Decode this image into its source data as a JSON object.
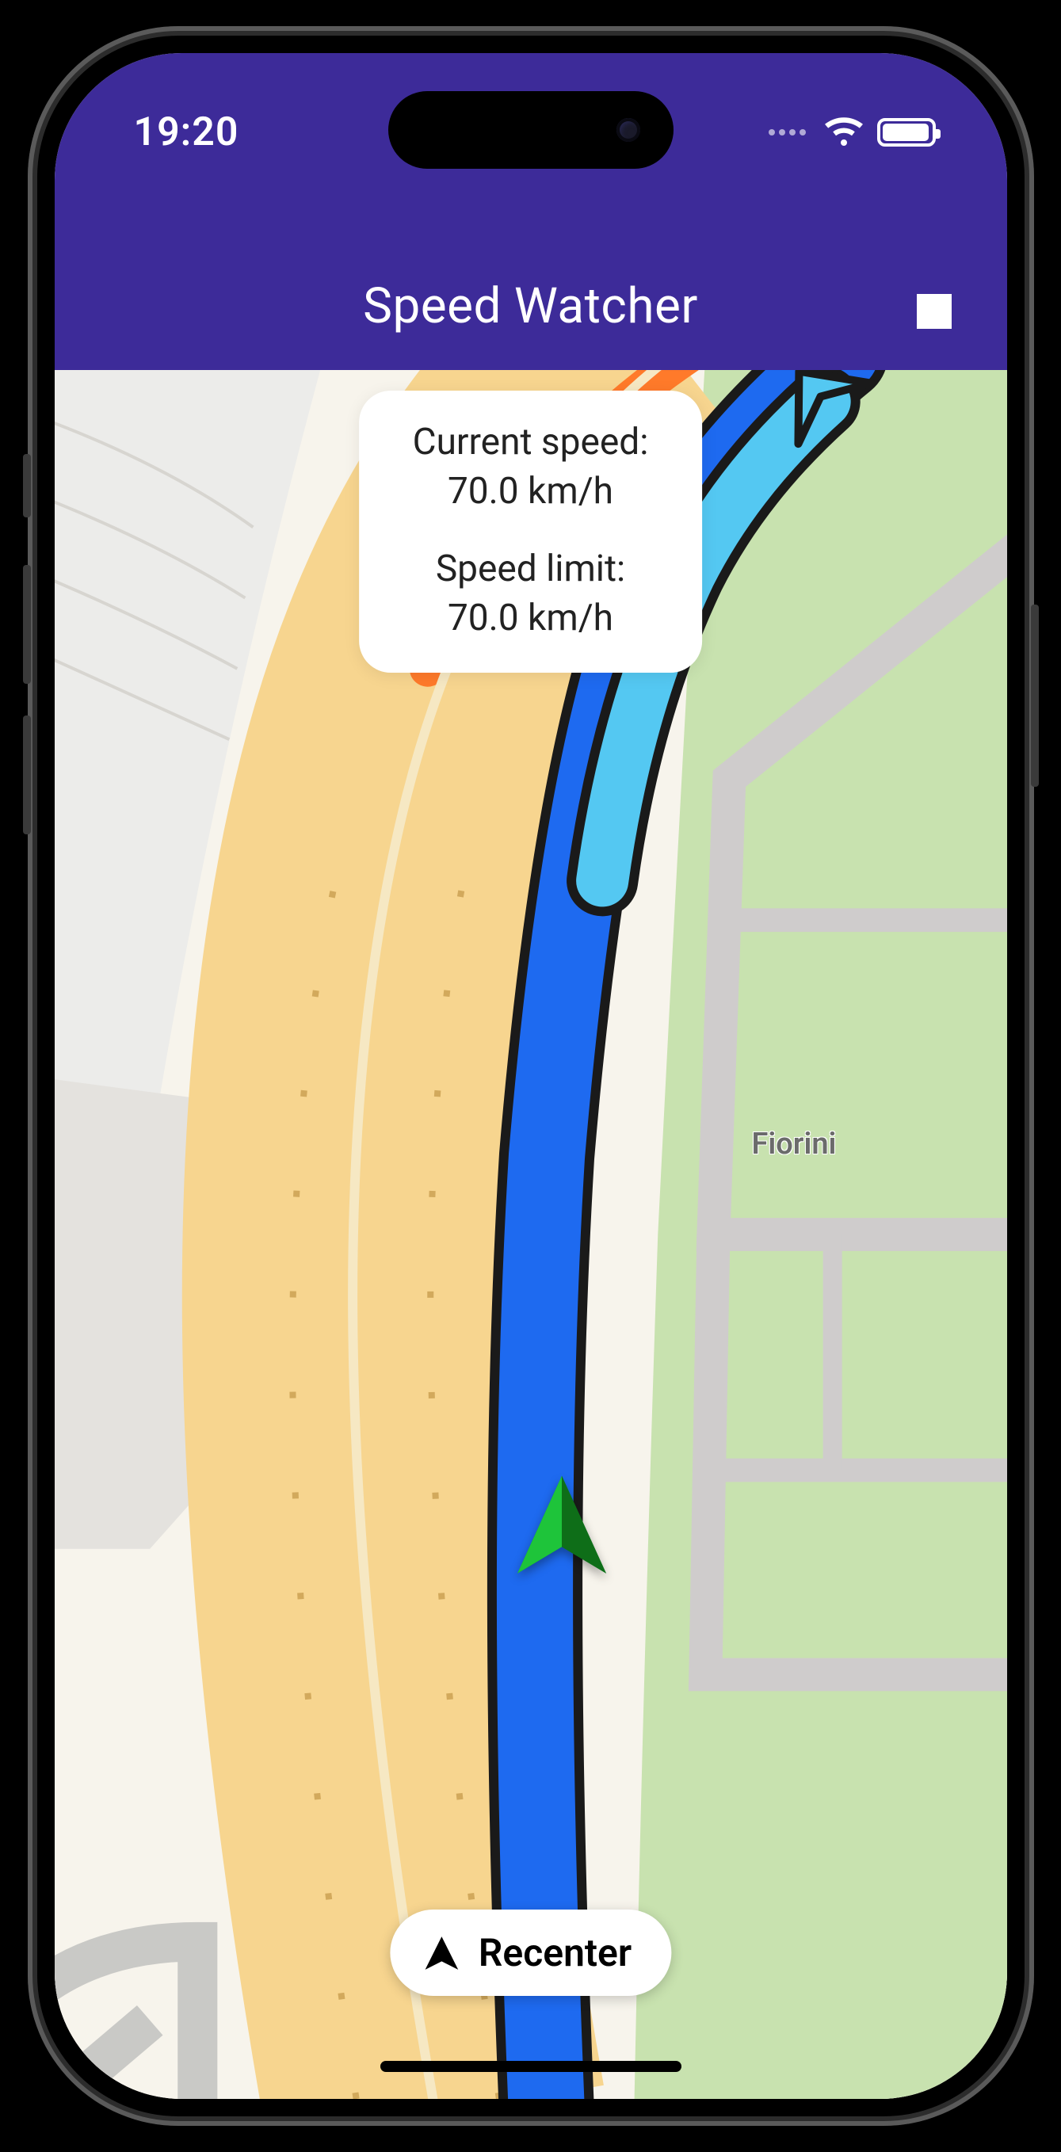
{
  "status": {
    "time": "19:20"
  },
  "header": {
    "title": "Speed Watcher"
  },
  "speed": {
    "current_label": "Current speed:",
    "current_value": "70.0 km/h",
    "limit_label": "Speed limit:",
    "limit_value": "70.0 km/h"
  },
  "map": {
    "place_label": "Fiorini"
  },
  "recenter": {
    "label": "Recenter"
  }
}
